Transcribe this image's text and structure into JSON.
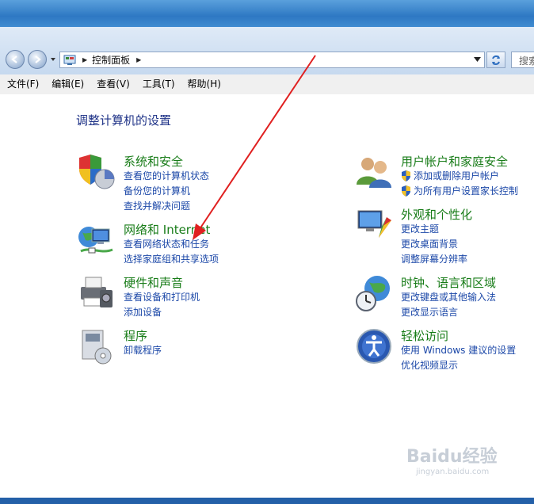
{
  "address": {
    "path": "控制面板",
    "search_placeholder": "搜索"
  },
  "menu": [
    "文件(F)",
    "编辑(E)",
    "查看(V)",
    "工具(T)",
    "帮助(H)"
  ],
  "page_title": "调整计算机的设置",
  "categories": {
    "security": {
      "title": "系统和安全",
      "links": [
        "查看您的计算机状态",
        "备份您的计算机",
        "查找并解决问题"
      ]
    },
    "network": {
      "title": "网络和 Internet",
      "links": [
        "查看网络状态和任务",
        "选择家庭组和共享选项"
      ]
    },
    "hardware": {
      "title": "硬件和声音",
      "links": [
        "查看设备和打印机",
        "添加设备"
      ]
    },
    "programs": {
      "title": "程序",
      "links": [
        "卸载程序"
      ]
    },
    "users": {
      "title": "用户帐户和家庭安全",
      "links": [
        "添加或删除用户帐户",
        "为所有用户设置家长控制"
      ]
    },
    "appearance": {
      "title": "外观和个性化",
      "links": [
        "更改主题",
        "更改桌面背景",
        "调整屏幕分辨率"
      ]
    },
    "clock": {
      "title": "时钟、语言和区域",
      "links": [
        "更改键盘或其他输入法",
        "更改显示语言"
      ]
    },
    "access": {
      "title": "轻松访问",
      "links": [
        "使用 Windows 建议的设置",
        "优化视频显示"
      ]
    }
  },
  "watermark": {
    "logo": "Baidu经验",
    "sub": "jingyan.baidu.com"
  },
  "colors": {
    "category_title": "#187c18",
    "link": "#1c48a8",
    "page_title": "#1e3287",
    "annotation_arrow": "#e02020"
  }
}
